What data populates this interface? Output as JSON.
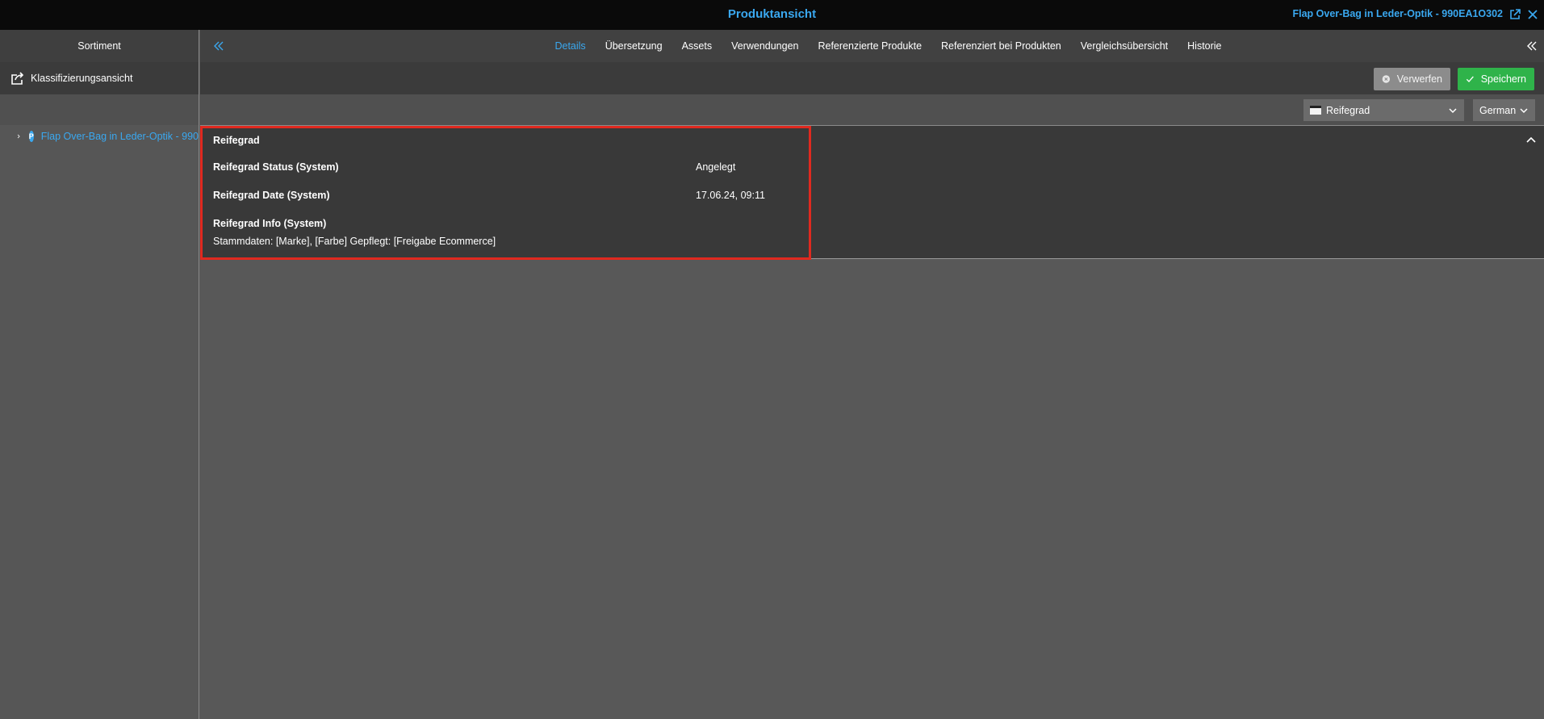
{
  "header": {
    "title": "Produktansicht",
    "product_title": "Flap Over-Bag in Leder-Optik - 990EA1O302"
  },
  "sidebar": {
    "title": "Sortiment",
    "classification_label": "Klassifizierungsansicht",
    "tree": [
      {
        "label": "Flap Over-Bag in Leder-Optik - 990",
        "badge": "P"
      }
    ]
  },
  "tabs": [
    {
      "label": "Details",
      "active": true
    },
    {
      "label": "Übersetzung"
    },
    {
      "label": "Assets"
    },
    {
      "label": "Verwendungen"
    },
    {
      "label": "Referenzierte Produkte"
    },
    {
      "label": "Referenziert bei Produkten"
    },
    {
      "label": "Vergleichsübersicht"
    },
    {
      "label": "Historie"
    }
  ],
  "actions": {
    "discard_label": "Verwerfen",
    "save_label": "Speichern"
  },
  "filters": {
    "facet_selected": "Reifegrad",
    "language_selected": "German"
  },
  "section": {
    "title": "Reifegrad",
    "fields": [
      {
        "label": "Reifegrad Status (System)",
        "value": "Angelegt"
      },
      {
        "label": "Reifegrad Date (System)",
        "value": "17.06.24, 09:11"
      },
      {
        "label": "Reifegrad Info (System)",
        "value": "Stammdaten: [Marke], [Farbe] Gepflegt: [Freigabe Ecommerce]"
      }
    ]
  },
  "colors": {
    "accent": "#3aa8f0",
    "save": "#2fb34a",
    "highlight": "#e0291f"
  }
}
